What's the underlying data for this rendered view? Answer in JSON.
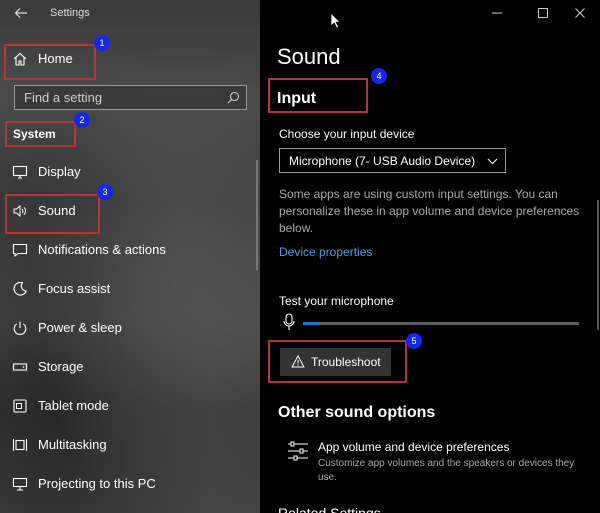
{
  "window": {
    "title": "Settings"
  },
  "sidebar": {
    "home_label": "Home",
    "search_placeholder": "Find a setting",
    "section_label": "System",
    "items": [
      {
        "label": "Display",
        "icon": "monitor-icon"
      },
      {
        "label": "Sound",
        "icon": "speaker-icon"
      },
      {
        "label": "Notifications & actions",
        "icon": "notification-icon"
      },
      {
        "label": "Focus assist",
        "icon": "moon-icon"
      },
      {
        "label": "Power & sleep",
        "icon": "power-icon"
      },
      {
        "label": "Storage",
        "icon": "drive-icon"
      },
      {
        "label": "Tablet mode",
        "icon": "tablet-icon"
      },
      {
        "label": "Multitasking",
        "icon": "multitasking-icon"
      },
      {
        "label": "Projecting to this PC",
        "icon": "projector-icon"
      }
    ]
  },
  "annotations": {
    "badges": [
      "1",
      "2",
      "3",
      "4",
      "5"
    ],
    "box_color": "#b5353a",
    "badge_color": "#1428e6"
  },
  "main": {
    "page_title": "Sound",
    "input_heading": "Input",
    "device_label": "Choose your input device",
    "device_value": "Microphone (7- USB Audio Device)",
    "description": "Some apps are using custom input settings. You can personalize these in app volume and device preferences below.",
    "device_properties_link": "Device properties",
    "test_mic_label": "Test your microphone",
    "mic_level": 0.06,
    "troubleshoot_label": "Troubleshoot",
    "other_options_title": "Other sound options",
    "app_volume_title": "App volume and device preferences",
    "app_volume_desc": "Customize app volumes and the speakers or devices they use.",
    "next_section_partial": "Related Settings"
  },
  "colors": {
    "accent_link": "#4a9ee8",
    "meter_fill": "#1976d2"
  }
}
